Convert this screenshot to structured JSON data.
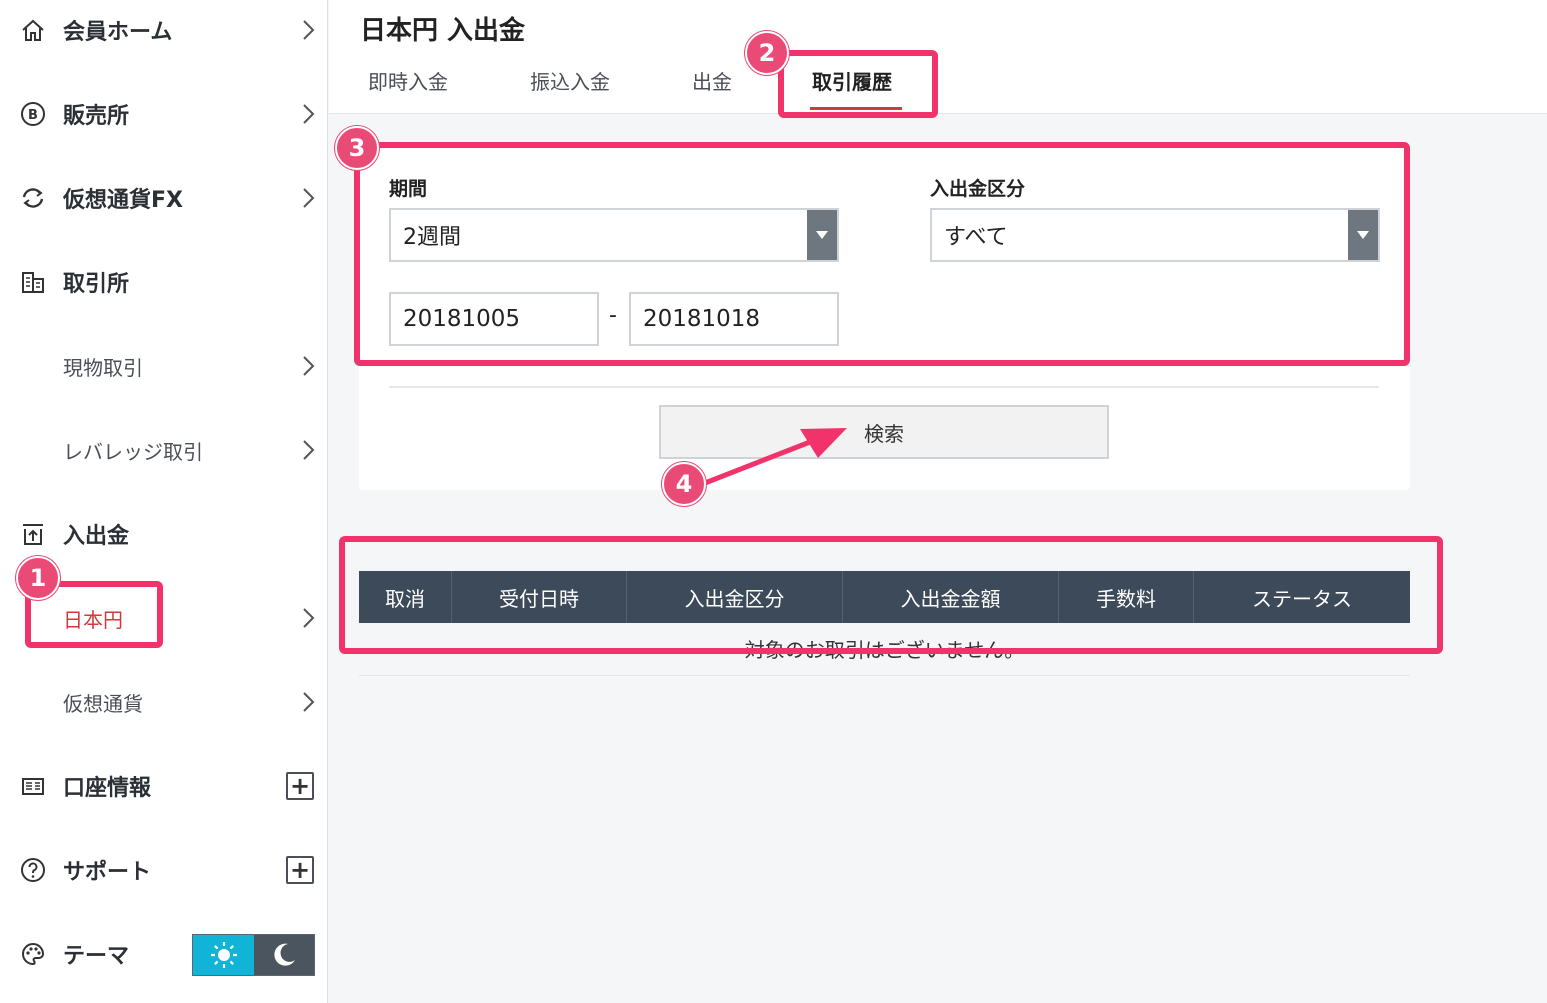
{
  "sidebar": {
    "items": [
      {
        "label": "会員ホーム",
        "icon": "home-icon"
      },
      {
        "label": "販売所",
        "icon": "bitcoin-icon"
      },
      {
        "label": "仮想通貨FX",
        "icon": "exchange-arrows-icon"
      },
      {
        "label": "取引所",
        "icon": "building-icon"
      },
      {
        "label": "現物取引"
      },
      {
        "label": "レバレッジ取引"
      },
      {
        "label": "入出金",
        "icon": "deposit-icon"
      },
      {
        "label": "日本円"
      },
      {
        "label": "仮想通貨"
      },
      {
        "label": "口座情報",
        "icon": "account-card-icon"
      },
      {
        "label": "サポート",
        "icon": "help-circle-icon"
      },
      {
        "label": "テーマ",
        "icon": "palette-icon"
      }
    ],
    "expand_symbol": "+",
    "active_item": "日本円"
  },
  "header": {
    "title": "日本円 入出金",
    "tabs": [
      {
        "label": "即時入金"
      },
      {
        "label": "振込入金"
      },
      {
        "label": "出金"
      },
      {
        "label": "取引履歴"
      }
    ],
    "active_tab": "取引履歴"
  },
  "filter": {
    "period_label": "期間",
    "period_value": "2週間",
    "type_label": "入出金区分",
    "type_value": "すべて",
    "date_from": "20181005",
    "date_separator": "-",
    "date_to": "20181018",
    "search_label": "検索"
  },
  "table": {
    "columns": [
      "取消",
      "受付日時",
      "入出金区分",
      "入出金金額",
      "手数料",
      "ステータス"
    ],
    "empty_message": "対象のお取引はございません。"
  },
  "annotations": {
    "badges": [
      "1",
      "2",
      "3",
      "4"
    ],
    "color": "#f2336b"
  },
  "colors": {
    "accent_red": "#d13a3a",
    "table_header": "#3d4a5a",
    "theme_light": "#0fb4d6",
    "theme_dark": "#4a5560",
    "annotation": "#f2336b"
  }
}
